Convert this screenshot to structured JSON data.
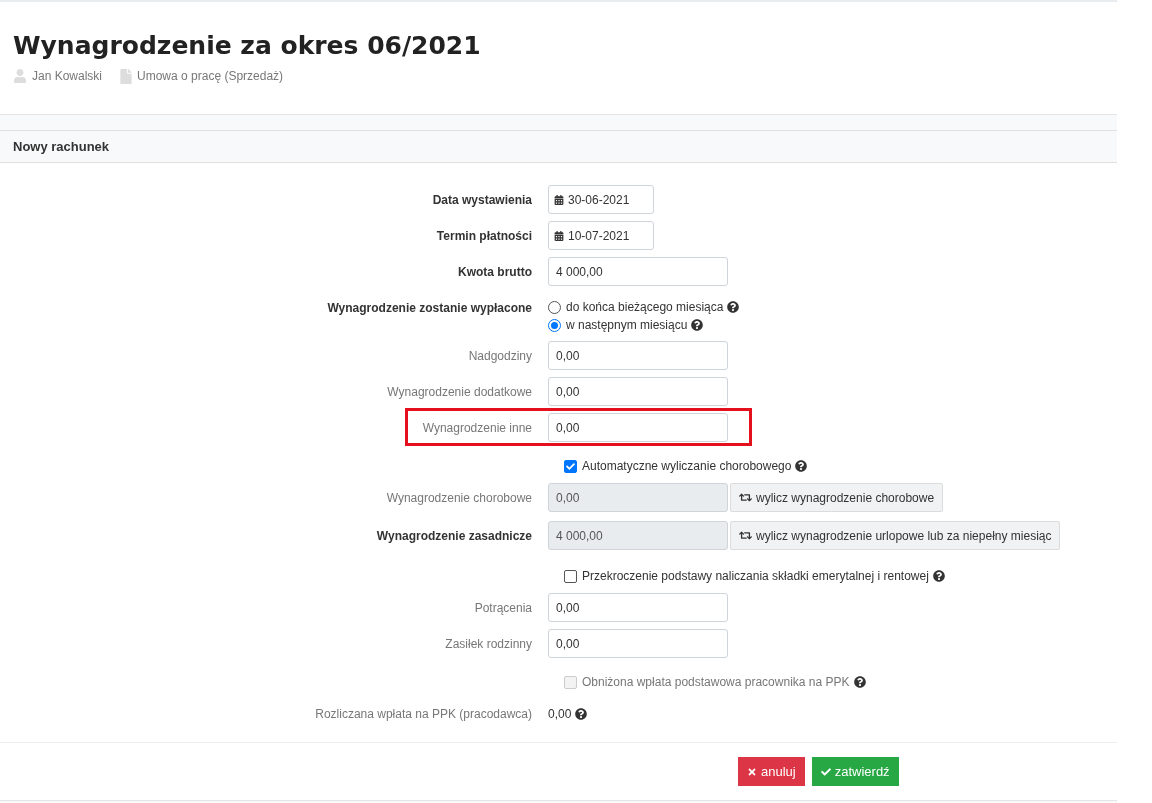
{
  "header": {
    "title": "Wynagrodzenie za okres 06/2021",
    "person": "Jan Kowalski",
    "contract": "Umowa o pracę (Sprzedaż)"
  },
  "section": {
    "title": "Nowy rachunek"
  },
  "rows": [
    {
      "kind": "date",
      "label": "Data wystawienia",
      "bold": true,
      "value": "30-06-2021"
    },
    {
      "kind": "date",
      "label": "Termin płatności",
      "bold": true,
      "value": "10-07-2021"
    },
    {
      "kind": "input",
      "label": "Kwota brutto",
      "bold": true,
      "value": "4 000,00"
    },
    {
      "kind": "radio",
      "label": "Wynagrodzenie zostanie wypłacone",
      "bold": true,
      "options": [
        {
          "label": "do końca bieżącego miesiąca",
          "selected": false
        },
        {
          "label": "w następnym miesiącu",
          "selected": true
        }
      ]
    },
    {
      "kind": "input",
      "label": "Nadgodziny",
      "bold": false,
      "value": "0,00"
    },
    {
      "kind": "input",
      "label": "Wynagrodzenie dodatkowe",
      "bold": false,
      "value": "0,00"
    },
    {
      "kind": "input",
      "label": "Wynagrodzenie inne",
      "bold": false,
      "value": "0,00",
      "highlighted": true
    },
    {
      "kind": "checkbox",
      "label": "Automatyczne wyliczanie chorobowego",
      "checked": true,
      "disabled": false
    },
    {
      "kind": "readonly",
      "label": "Wynagrodzenie chorobowe",
      "bold": false,
      "value": "0,00",
      "button": "wylicz wynagrodzenie chorobowe"
    },
    {
      "kind": "readonly",
      "label": "Wynagrodzenie zasadnicze",
      "bold": true,
      "value": "4 000,00",
      "button": "wylicz wynagrodzenie urlopowe lub za niepełny miesiąc"
    },
    {
      "kind": "checkbox",
      "label": "Przekroczenie podstawy naliczania składki emerytalnej i rentowej",
      "checked": false,
      "disabled": false
    },
    {
      "kind": "input",
      "label": "Potrącenia",
      "bold": false,
      "value": "0,00"
    },
    {
      "kind": "input",
      "label": "Zasiłek rodzinny",
      "bold": false,
      "value": "0,00"
    },
    {
      "kind": "checkbox",
      "label": "Obniżona wpłata podstawowa pracownika na PPK",
      "checked": false,
      "disabled": true
    },
    {
      "kind": "static",
      "label": "Rozliczana wpłata na PPK (pracodawca)",
      "bold": false,
      "value": "0,00"
    }
  ],
  "buttons": {
    "cancel": "anuluj",
    "confirm": "zatwierdź"
  }
}
